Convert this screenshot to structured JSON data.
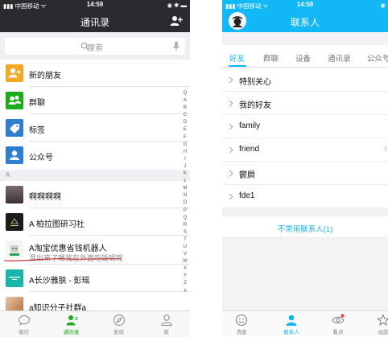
{
  "left": {
    "status": {
      "carrier": "▮▮▮ 中国移动 ᯤ",
      "time": "14:59",
      "right": "◉ ✱ ▬"
    },
    "nav_title": "通讯录",
    "search_placeholder": "搜索",
    "special_rows": [
      {
        "label": "新的朋友",
        "color": "#f5a623"
      },
      {
        "label": "群聊",
        "color": "#1aad19"
      },
      {
        "label": "标签",
        "color": "#2f7fd1"
      },
      {
        "label": "公众号",
        "color": "#2f7fd1"
      }
    ],
    "section_a": "A",
    "contacts": [
      {
        "name": "啊啊啊啊"
      },
      {
        "name": "A 柏拉图研习社"
      },
      {
        "name": "A淘宝优惠省钱机器人",
        "subtitle": "混出来了嗯我在外面吃饭呢呢"
      },
      {
        "name": "A长沙雅肤 - 彭瑶"
      },
      {
        "name": "a知识分子社群a"
      }
    ],
    "index_letters": [
      "Q",
      "A",
      "B",
      "C",
      "D",
      "E",
      "F",
      "G",
      "H",
      "I",
      "J",
      "K",
      "L",
      "M",
      "N",
      "O",
      "P",
      "Q",
      "R",
      "S",
      "T",
      "U",
      "V",
      "W",
      "X",
      "Y",
      "Z",
      "#"
    ],
    "tabs": [
      {
        "label": "微信"
      },
      {
        "label": "通讯录"
      },
      {
        "label": "发现"
      },
      {
        "label": "我"
      }
    ]
  },
  "right": {
    "status": {
      "carrier": "▮▮▮ 中国移动 ᯤ",
      "time": "14:59",
      "right": "◉"
    },
    "nav_title": "联系人",
    "tabs": [
      "好友",
      "群聊",
      "设备",
      "通讯录",
      "公众号"
    ],
    "groups": [
      {
        "name": "特别关心",
        "count": ""
      },
      {
        "name": "我的好友",
        "count": ""
      },
      {
        "name": "family",
        "count": ""
      },
      {
        "name": "friend",
        "count": "1"
      },
      {
        "name": "鬱屙",
        "count": ""
      },
      {
        "name": "fde1",
        "count": ""
      }
    ],
    "uncommon": "不常用联系人(1)",
    "bottom_tabs": [
      {
        "label": "消息"
      },
      {
        "label": "联系人"
      },
      {
        "label": "看点"
      },
      {
        "label": "动态"
      }
    ]
  },
  "colors": {
    "wechat_green": "#1aad19",
    "qq_blue": "#12b7f5",
    "annotation_red": "#c21a1a"
  }
}
